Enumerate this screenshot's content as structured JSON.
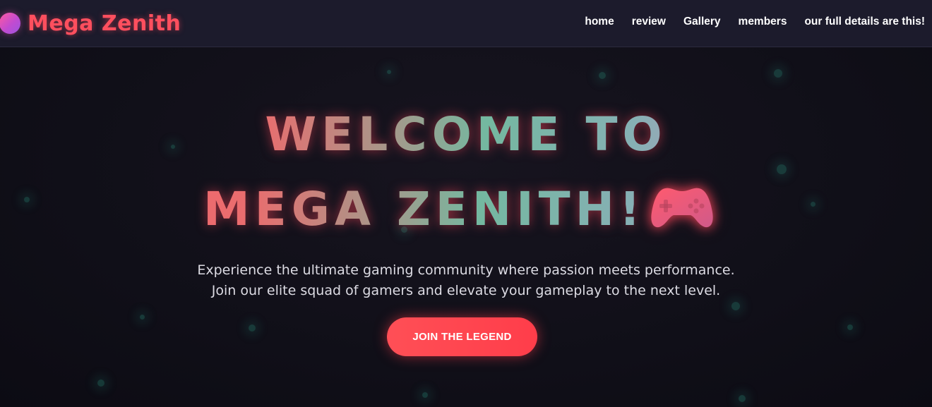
{
  "brand": {
    "name": "Mega Zenith",
    "logo_gradient": [
      "#ff5aa0",
      "#9b55e0"
    ],
    "accent_color": "#ff4f5e"
  },
  "nav": {
    "items": [
      {
        "label": "home"
      },
      {
        "label": "review"
      },
      {
        "label": "Gallery"
      },
      {
        "label": "members"
      },
      {
        "label": "our full details are this!"
      }
    ]
  },
  "hero": {
    "title_line1": "WELCOME TO",
    "title_line2": "MEGA ZENITH!",
    "title_icon": "gamepad-icon",
    "subtitle_line1": "Experience the ultimate gaming community where passion meets performance.",
    "subtitle_line2": "Join our elite squad of gamers and elevate your gameplay to the next level.",
    "cta_label": "JOIN THE LEGEND"
  },
  "colors": {
    "background": "#0f0e18",
    "navbar": "#1c1b2c",
    "button": "#ff4452",
    "subtitle_text": "#dcdbe3"
  }
}
